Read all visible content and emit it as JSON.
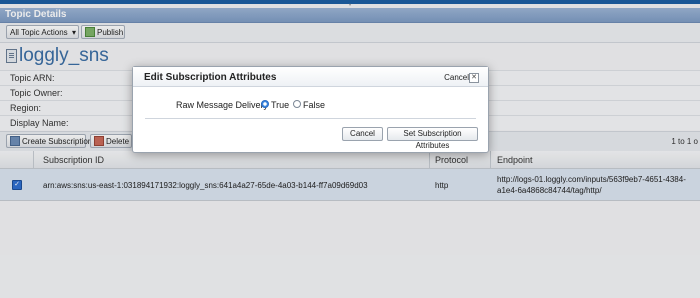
{
  "panel": {
    "title": "Topic Details"
  },
  "toolbar": {
    "all_topic_actions": "All Topic Actions",
    "publish": "Publish"
  },
  "topic": {
    "title": "loggly_sns"
  },
  "details": [
    {
      "label": "Topic ARN:"
    },
    {
      "label": "Topic Owner:"
    },
    {
      "label": "Region:"
    },
    {
      "label": "Display Name:"
    }
  ],
  "table_toolbar": {
    "create_subscription": "Create Subscription",
    "delete_partial": "Delete",
    "pager_partial": "1 to 1 o"
  },
  "table": {
    "columns": [
      "Subscription ID",
      "Protocol",
      "Endpoint"
    ],
    "rows": [
      {
        "selected": true,
        "subscription_id": "arn:aws:sns:us-east-1:031894171932:loggly_sns:641a4a27-65de-4a03-b144-ff7a09d69d03",
        "protocol": "http",
        "endpoint_line1": "http://logs-01.loggly.com/inputs/563f9eb7-4651-4384-",
        "endpoint_line2": "a1e4-6a4868c84744/tag/http/"
      }
    ]
  },
  "modal": {
    "title": "Edit Subscription Attributes",
    "cancel_link": "Cancel",
    "close_icon": "close-icon",
    "field_label": "Raw Message Delivery",
    "options": [
      {
        "label": "True",
        "selected": true
      },
      {
        "label": "False",
        "selected": false
      }
    ],
    "cancel_button": "Cancel",
    "submit_button": "Set Subscription Attributes"
  },
  "colors": {
    "header_blue": "#1d5fa3",
    "title_blue": "#3b6ea5",
    "selected_row": "#dce5f1",
    "radio_selected": "#3b87e0"
  }
}
